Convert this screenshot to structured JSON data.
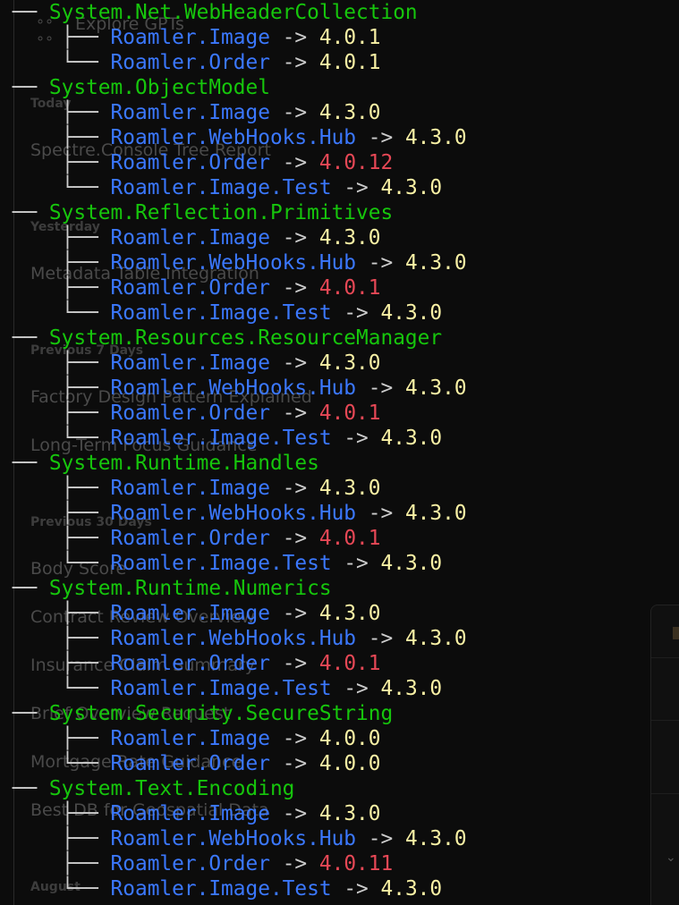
{
  "background_sidebar": {
    "top_item": "Explore GPTs",
    "sections": [
      {
        "label": "Today",
        "items": [
          "Spectre.Console Tree Report"
        ]
      },
      {
        "label": "Yesterday",
        "items": [
          "Metadata Table Integration"
        ]
      },
      {
        "label": "Previous 7 Days",
        "items": [
          "Factory Design Pattern Explained",
          "Long-Term Focus Guidance"
        ]
      },
      {
        "label": "Previous 30 Days",
        "items": [
          "Body Score",
          "Contract Review Overview",
          "Insurance Claim Summary",
          "Brief Overview Request",
          "Mortgage Rate Guidance",
          "Best DB for Geospatial Data"
        ]
      },
      {
        "label": "August",
        "items": []
      }
    ],
    "ghost_icon": "grid-icon",
    "panel_icon": "chevron-down-icon"
  },
  "tree": [
    {
      "package": "System.Net.WebHeaderCollection",
      "children": [
        {
          "project": "Roamler.Image",
          "version": "4.0.1",
          "mismatch": false
        },
        {
          "project": "Roamler.Order",
          "version": "4.0.1",
          "mismatch": false
        }
      ]
    },
    {
      "package": "System.ObjectModel",
      "children": [
        {
          "project": "Roamler.Image",
          "version": "4.3.0",
          "mismatch": false
        },
        {
          "project": "Roamler.WebHooks.Hub",
          "version": "4.3.0",
          "mismatch": false
        },
        {
          "project": "Roamler.Order",
          "version": "4.0.12",
          "mismatch": true
        },
        {
          "project": "Roamler.Image.Test",
          "version": "4.3.0",
          "mismatch": false
        }
      ]
    },
    {
      "package": "System.Reflection.Primitives",
      "children": [
        {
          "project": "Roamler.Image",
          "version": "4.3.0",
          "mismatch": false
        },
        {
          "project": "Roamler.WebHooks.Hub",
          "version": "4.3.0",
          "mismatch": false
        },
        {
          "project": "Roamler.Order",
          "version": "4.0.1",
          "mismatch": true
        },
        {
          "project": "Roamler.Image.Test",
          "version": "4.3.0",
          "mismatch": false
        }
      ]
    },
    {
      "package": "System.Resources.ResourceManager",
      "children": [
        {
          "project": "Roamler.Image",
          "version": "4.3.0",
          "mismatch": false
        },
        {
          "project": "Roamler.WebHooks.Hub",
          "version": "4.3.0",
          "mismatch": false
        },
        {
          "project": "Roamler.Order",
          "version": "4.0.1",
          "mismatch": true
        },
        {
          "project": "Roamler.Image.Test",
          "version": "4.3.0",
          "mismatch": false
        }
      ]
    },
    {
      "package": "System.Runtime.Handles",
      "children": [
        {
          "project": "Roamler.Image",
          "version": "4.3.0",
          "mismatch": false
        },
        {
          "project": "Roamler.WebHooks.Hub",
          "version": "4.3.0",
          "mismatch": false
        },
        {
          "project": "Roamler.Order",
          "version": "4.0.1",
          "mismatch": true
        },
        {
          "project": "Roamler.Image.Test",
          "version": "4.3.0",
          "mismatch": false
        }
      ]
    },
    {
      "package": "System.Runtime.Numerics",
      "children": [
        {
          "project": "Roamler.Image",
          "version": "4.3.0",
          "mismatch": false
        },
        {
          "project": "Roamler.WebHooks.Hub",
          "version": "4.3.0",
          "mismatch": false
        },
        {
          "project": "Roamler.Order",
          "version": "4.0.1",
          "mismatch": true
        },
        {
          "project": "Roamler.Image.Test",
          "version": "4.3.0",
          "mismatch": false
        }
      ]
    },
    {
      "package": "System.Security.SecureString",
      "children": [
        {
          "project": "Roamler.Image",
          "version": "4.0.0",
          "mismatch": false
        },
        {
          "project": "Roamler.Order",
          "version": "4.0.0",
          "mismatch": false
        }
      ]
    },
    {
      "package": "System.Text.Encoding",
      "children": [
        {
          "project": "Roamler.Image",
          "version": "4.3.0",
          "mismatch": false
        },
        {
          "project": "Roamler.WebHooks.Hub",
          "version": "4.3.0",
          "mismatch": false
        },
        {
          "project": "Roamler.Order",
          "version": "4.0.11",
          "mismatch": true
        },
        {
          "project": "Roamler.Image.Test",
          "version": "4.3.0",
          "mismatch": false
        }
      ]
    }
  ],
  "glyphs": {
    "package_branch": "── ",
    "child_branch": "├── ",
    "last_branch": "└── ",
    "indent": "  ",
    "arrow": " -> "
  },
  "colors": {
    "background": "#0c0c0c",
    "tree_lines": "#cccccc",
    "package": "#16c60c",
    "project": "#3b78ff",
    "version": "#f9f1a5",
    "version_mismatch": "#e74856"
  }
}
